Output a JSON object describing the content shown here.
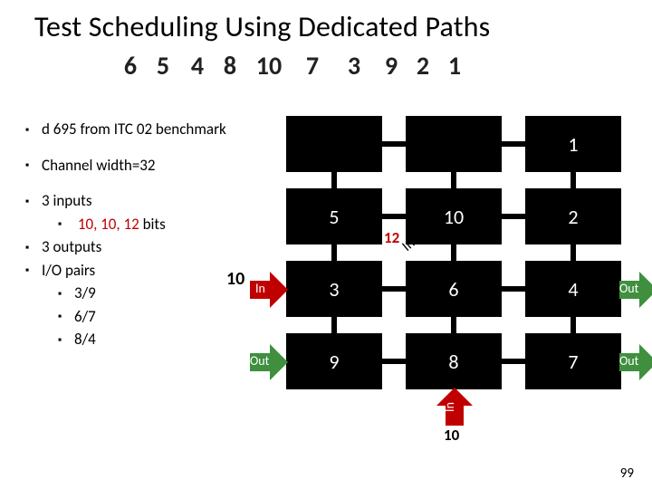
{
  "title": "Test Scheduling Using Dedicated Paths",
  "number_row": [
    "6",
    "5",
    "4",
    "8",
    "10",
    "7",
    "3",
    "9",
    "2",
    "1"
  ],
  "bullets": {
    "b1": "d 695 from ITC 02 benchmark",
    "b2": "Channel width=32",
    "b3": "3 inputs",
    "b3_sub_pre": "",
    "b3_sub_a": "10",
    "b3_sub_sep1": ", ",
    "b3_sub_b": "10",
    "b3_sub_sep2": ", ",
    "b3_sub_c": "12",
    "b3_sub_tail": " bits",
    "b4": "3 outputs",
    "b5": "I/O pairs",
    "b5_sub1": "3/9",
    "b5_sub2": "6/7",
    "b5_sub3": "8/4"
  },
  "grid": {
    "r1": [
      "",
      "",
      "1"
    ],
    "r2": [
      "5",
      "10",
      "2"
    ],
    "r3": [
      "3",
      "6",
      "4"
    ],
    "r4": [
      "9",
      "8",
      "7"
    ]
  },
  "badges": {
    "b12": "12",
    "b_in_left": "In",
    "b_out_left": "Out",
    "b_in_diag": "In",
    "b_in_bot": "In",
    "b10_bot": "10",
    "b10_side": "10"
  },
  "arrows": {
    "out_r3": "Out",
    "out_r4": "Out"
  },
  "pagenum": "99"
}
